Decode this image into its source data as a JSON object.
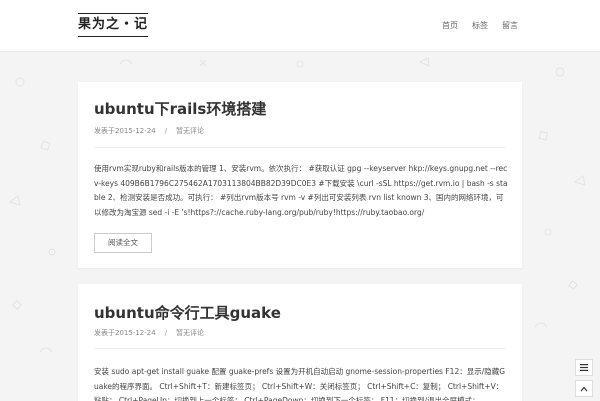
{
  "site": {
    "logo": "果为之・记"
  },
  "nav": {
    "items": [
      {
        "label": "首页"
      },
      {
        "label": "标签"
      },
      {
        "label": "留言"
      }
    ]
  },
  "posts": [
    {
      "title": "ubuntu下rails环境搭建",
      "date": "发表于2015-12-24",
      "separator": "/",
      "comments": "暂无评论",
      "excerpt": "使用rvm实现ruby和rails版本的管理 1、安装rvm。依次执行： #获取认证 gpg --keyserver hkp://keys.gnupg.net --recv-keys 409B6B1796C275462A1703113804BB82D39DC0E3 #下载安装 \\curl -sSL https://get.rvm.io | bash -s stable 2、检测安装是否成功。可执行： #列出rvm版本号 rvm -v #列出可安装列表 rvn list known 3、国内的网络环境，可以修改为淘宝源 sed -i -E 's!https?://cache.ruby-lang.org/pub/ruby!https://ruby.taobao.org/",
      "read_more": "阅读全文"
    },
    {
      "title": "ubuntu命令行工具guake",
      "date": "发表于2015-12-24",
      "separator": "/",
      "comments": "暂无评论",
      "excerpt": "安装 sudo apt-get install guake 配置 guake-prefs 设置为开机自动启动 gnome-session-properties F12：显示/隐藏Guake的程序界面。 Ctrl+Shift+T：新建标签页； Ctrl+Shift+W：关闭标签页； Ctrl+Shift+C：复制； Ctrl+Shift+V：粘贴； Ctrl+PageUp：切换到上一个标签； Ctrl+PageDown：切换到下一个标签； F11：切换到/退出全屏模式；"
    }
  ],
  "icons": {
    "menu": "menu-icon",
    "top": "arrow-up-icon"
  }
}
